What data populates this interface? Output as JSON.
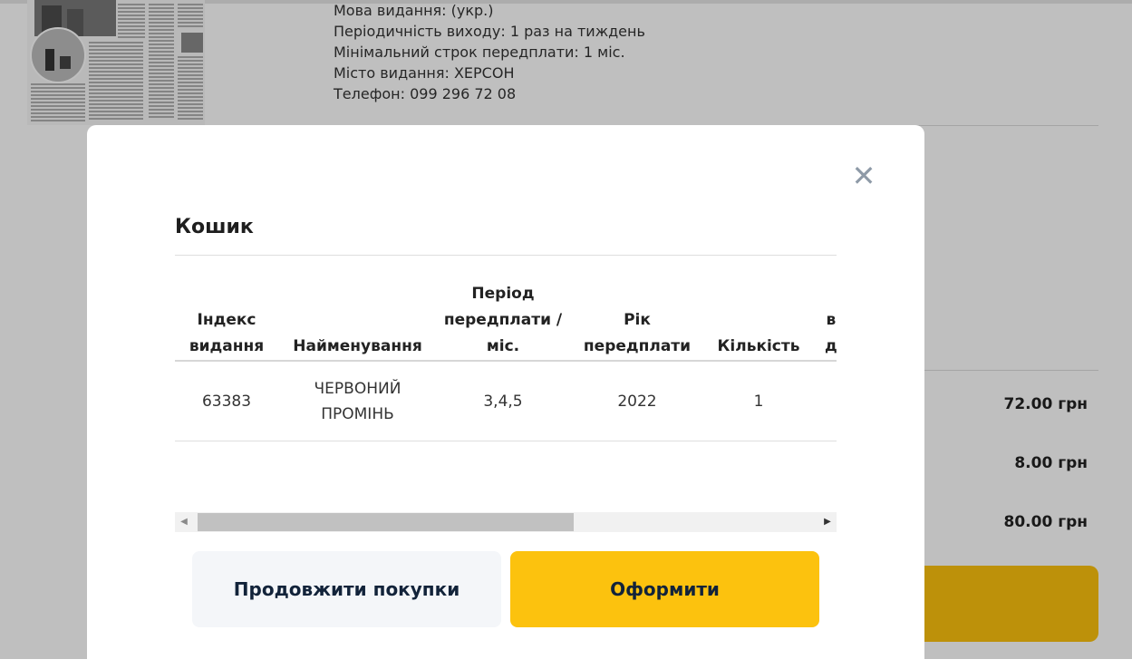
{
  "background": {
    "info_lines": [
      "Мова видання: (укр.)",
      "Періодичність виходу: 1 раз на тиждень",
      "Мінімальний строк передплати: 1 міс.",
      "Місто видання: ХЕРСОН",
      "Телефон: 099 296 72 08"
    ],
    "prices": [
      "72.00 грн",
      "8.00 грн",
      "80.00 грн"
    ]
  },
  "cart": {
    "title": "Кошик",
    "close_icon": "close-icon",
    "columns": [
      "Індекс видання",
      "Найменування",
      "Період передплати / міс.",
      "Рік передплати",
      "Кількість"
    ],
    "rows": [
      {
        "index": "63383",
        "name": "ЧЕРВОНИЙ ПРОМІНЬ",
        "period": "3,4,5",
        "year": "2022",
        "quantity": "1"
      }
    ],
    "buttons": {
      "continue": "Продовжити покупки",
      "checkout": "Оформити"
    }
  },
  "colors": {
    "accent": "#fcc20e",
    "button_text": "#12233a"
  }
}
